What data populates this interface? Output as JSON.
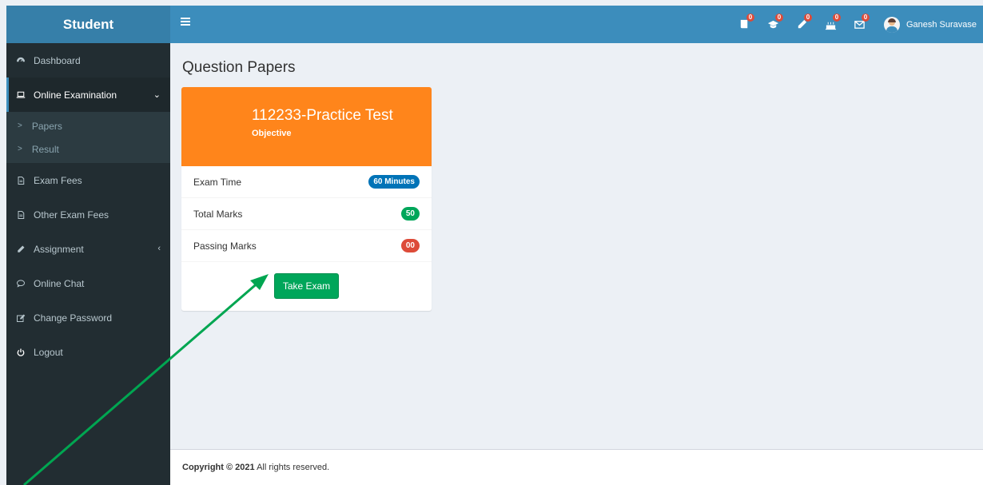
{
  "brand": "Student",
  "topbar": {
    "icons": [
      {
        "name": "book-icon",
        "badge": "0"
      },
      {
        "name": "graduation-cap-icon",
        "badge": "0"
      },
      {
        "name": "pencil-icon",
        "badge": "0"
      },
      {
        "name": "cake-icon",
        "badge": "0"
      },
      {
        "name": "envelope-icon",
        "badge": "0"
      }
    ],
    "user_name": "Ganesh Suravase"
  },
  "sidebar": {
    "dashboard": "Dashboard",
    "online_examination": "Online Examination",
    "papers": "Papers",
    "result": "Result",
    "exam_fees": "Exam Fees",
    "other_exam_fees": "Other Exam Fees",
    "assignment": "Assignment",
    "online_chat": "Online Chat",
    "change_password": "Change Password",
    "logout": "Logout"
  },
  "main": {
    "page_title": "Question Papers",
    "card": {
      "title": "112233-Practice Test",
      "subtitle": "Objective",
      "rows": [
        {
          "label": "Exam Time",
          "value": "60 Minutes",
          "color": "#0073b7"
        },
        {
          "label": "Total Marks",
          "value": "50",
          "color": "#00a65a"
        },
        {
          "label": "Passing Marks",
          "value": "00",
          "color": "#dd4b39"
        }
      ],
      "button": "Take Exam"
    }
  },
  "footer": {
    "copyright": "Copyright © 2021",
    "rest": " All rights reserved."
  },
  "colors": {
    "header": "#3c8dbc",
    "sidebar": "#222d32",
    "card_header": "#ff851b",
    "arrow": "#00a651"
  }
}
